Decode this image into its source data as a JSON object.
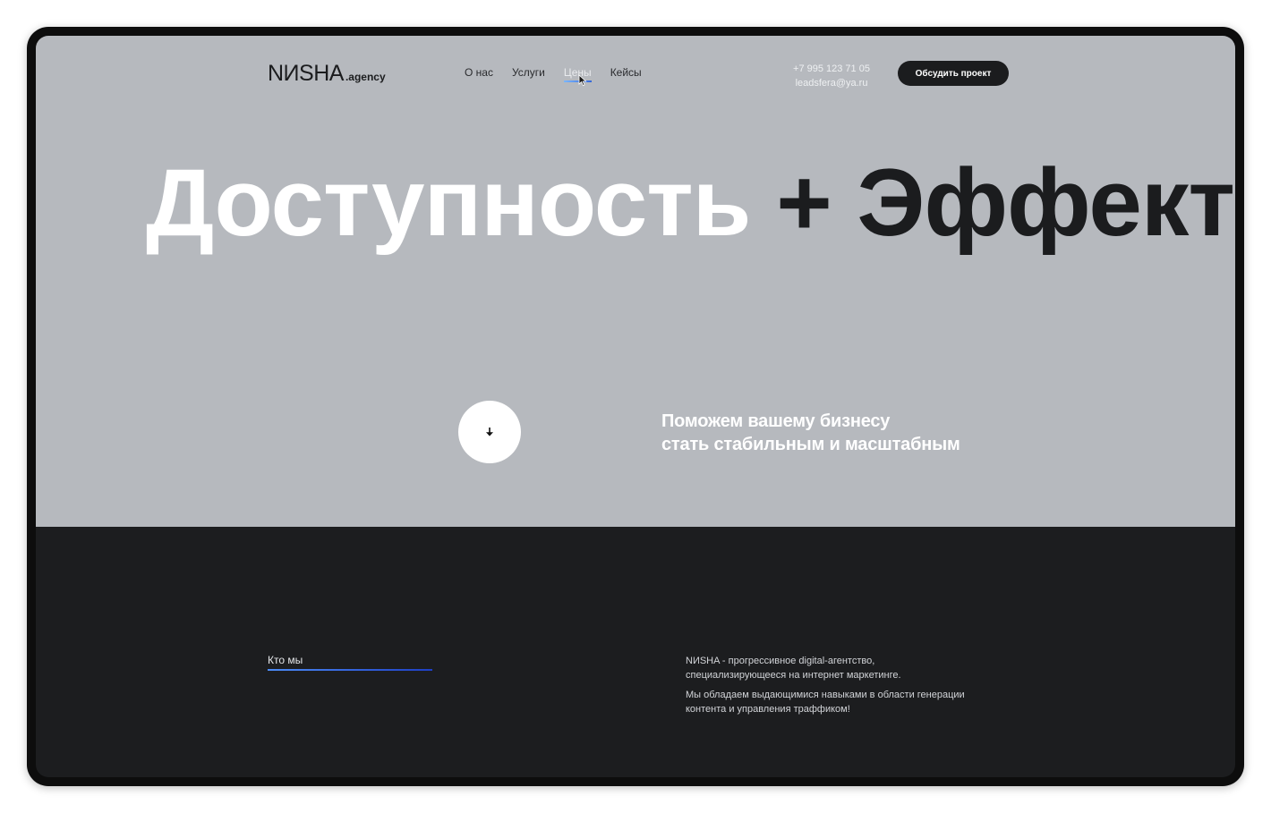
{
  "header": {
    "logo_main": "NИSHA",
    "logo_sub": ".agency",
    "nav": [
      {
        "label": "О нас"
      },
      {
        "label": "Услуги"
      },
      {
        "label": "Цены",
        "active": true
      },
      {
        "label": "Кейсы"
      }
    ],
    "phone": "+7 995 123 71 05",
    "email": "leadsfera@ya.ru",
    "cta_label": "Обсудить проект"
  },
  "hero": {
    "headline_white": "Доступность",
    "headline_dark": "+ Эффективность",
    "tagline_line1": "Поможем вашему бизнесу",
    "tagline_line2": "стать стабильным и масштабным",
    "scroll_icon": "arrow-down-icon"
  },
  "about": {
    "label": "Кто мы",
    "p1_line1": "NИSHA - прогрессивное digital-агентство,",
    "p1_line2": "специализирующееся на интернет маркетинге.",
    "p2_line1": "Мы обладаем выдающимися навыками в области генерации",
    "p2_line2": "контента и управления траффиком!"
  },
  "colors": {
    "hero_bg": "#b6b9be",
    "dark_bg": "#1c1d1f",
    "accent": "#3467d8"
  }
}
